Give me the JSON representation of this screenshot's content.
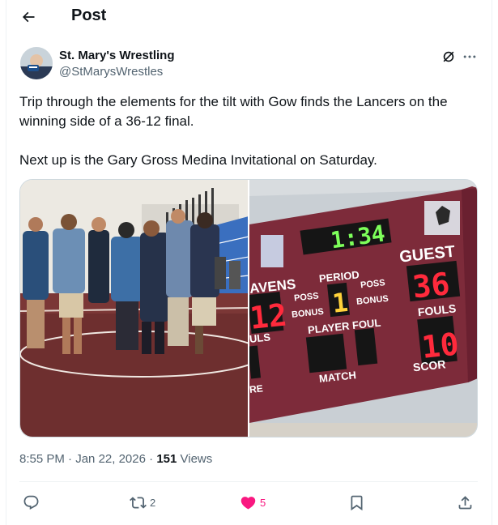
{
  "header": {
    "title": "Post"
  },
  "author": {
    "name": "St. Mary's Wrestling",
    "handle": "@StMarysWrestles"
  },
  "tweet": {
    "line1": "Trip through the elements for the tilt with Gow finds the Lancers on the winning side of a 36-12 final.",
    "line2": "Next up is the Gary Gross Medina Invitational on Saturday."
  },
  "scoreboard": {
    "clock": "1:34",
    "guest_label": "GUEST",
    "home_label_partial": "AVENS",
    "guest_score": "36",
    "home_score_partial": "12",
    "period_label": "PERIOD",
    "period_value": "1",
    "poss_label": "POSS",
    "bonus_label": "BONUS",
    "fouls_label": "FOULS",
    "fouls_partial": "ULS",
    "guest_fouls": "10",
    "player_foul_label": "PLAYER FOUL",
    "match_label": "MATCH",
    "score_label_partial": "SCOR",
    "re_partial": "RE"
  },
  "meta": {
    "time": "8:55 PM",
    "date": "Jan 22, 2026",
    "views_count": "151",
    "views_label": "Views",
    "sep": "·"
  },
  "actions": {
    "reposts": "2",
    "likes": "5"
  },
  "colors": {
    "like": "#f91880",
    "muted": "#536471",
    "text": "#0f1419",
    "board": "#7a2a3a",
    "led_red": "#ff2a3c",
    "led_green": "#7dff5a"
  },
  "icons": [
    "back-arrow-icon",
    "grok-icon",
    "more-icon",
    "reply-icon",
    "repost-icon",
    "like-icon",
    "bookmark-icon",
    "share-icon"
  ]
}
